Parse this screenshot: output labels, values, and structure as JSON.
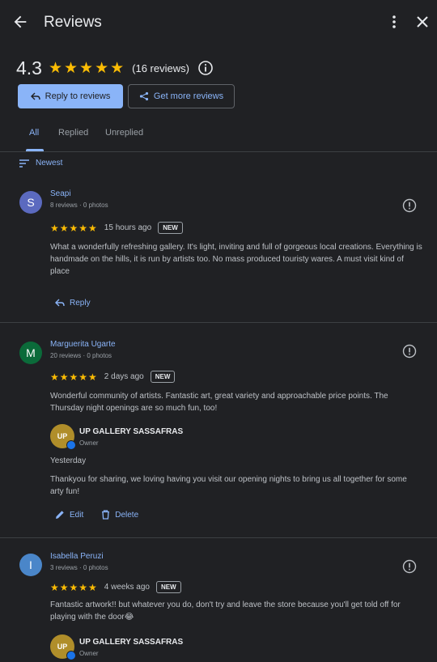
{
  "header": {
    "title": "Reviews"
  },
  "summary": {
    "rating": "4.3",
    "stars": "★★★★★",
    "count": "(16 reviews)"
  },
  "buttons": {
    "reply": "Reply to reviews",
    "get_more": "Get more reviews"
  },
  "tabs": [
    {
      "label": "All"
    },
    {
      "label": "Replied"
    },
    {
      "label": "Unreplied"
    }
  ],
  "sort": {
    "label": "Newest"
  },
  "reviews": [
    {
      "initial": "S",
      "avatar_color": "#5b6abf",
      "name": "Seapi",
      "meta": "8 reviews · 0 photos",
      "stars": "★★★★★",
      "when": "15 hours ago",
      "badge": "NEW",
      "text": "What a wonderfully refreshing gallery. It's light, inviting and full of gorgeous local creations. Everything is handmade on the hills, it is run by artists too. No mass produced touristy wares. A must visit kind of place",
      "reply_label": "Reply"
    },
    {
      "initial": "M",
      "avatar_color": "#0b6b3a",
      "name": "Marguerita Ugarte",
      "meta": "20 reviews · 0 photos",
      "stars": "★★★★★",
      "when": "2 days ago",
      "badge": "NEW",
      "text": "Wonderful community of artists. Fantastic art, great variety and approachable price points. The Thursday night openings are so much fun, too!",
      "owner": {
        "logo": "UP",
        "name": "UP GALLERY SASSAFRAS",
        "role": "Owner",
        "when": "Yesterday",
        "text": "Thankyou for sharing, we loving having you visit our opening nights to bring us all together for some arty fun!",
        "edit": "Edit",
        "delete": "Delete"
      }
    },
    {
      "initial": "I",
      "avatar_color": "#4a86c9",
      "name": "Isabella Peruzi",
      "meta": "3 reviews · 0 photos",
      "stars": "★★★★★",
      "when": "4 weeks ago",
      "badge": "NEW",
      "text": "Fantastic artwork!! but whatever you do, don't try and leave the store because you'll get told off for playing with the door😂",
      "owner": {
        "logo": "UP",
        "name": "UP GALLERY SASSAFRAS",
        "role": "Owner"
      }
    }
  ]
}
